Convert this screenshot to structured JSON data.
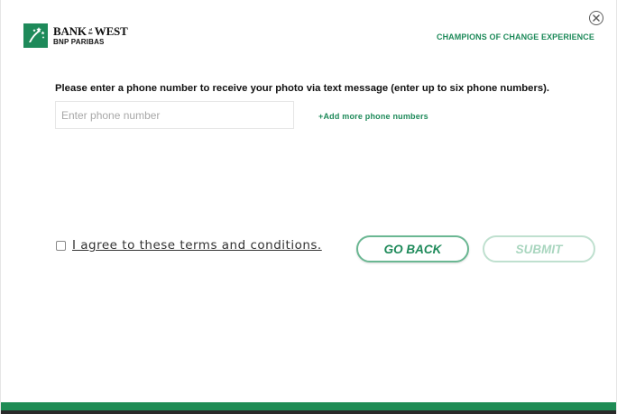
{
  "brand": {
    "line1_left": "BANK",
    "line1_ofthe": "of the",
    "line1_right": "WEST",
    "line2": "BNP PARIBAS",
    "logo_icon": "stars-logo-icon",
    "color": "#1e8a5a"
  },
  "header": {
    "tagline": "CHAMPIONS OF CHANGE EXPERIENCE",
    "close_icon": "close-icon"
  },
  "form": {
    "prompt": "Please enter a phone number to receive your photo via text message (enter up to six phone numbers).",
    "phone_placeholder": "Enter phone number",
    "phone_value": "",
    "add_more_label": "+Add more phone numbers"
  },
  "terms": {
    "checked": false,
    "label": "I agree to these terms and conditions."
  },
  "actions": {
    "back_label": "GO BACK",
    "submit_label": "SUBMIT",
    "submit_enabled": false
  },
  "colors": {
    "accent": "#1e8a5a",
    "accent_light": "#6ab792",
    "disabled": "#bfe0cf",
    "footer": "#1f8c55"
  }
}
